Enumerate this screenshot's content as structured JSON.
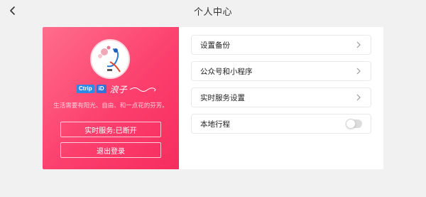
{
  "header": {
    "title": "个人中心",
    "back_icon": "chevron-left-icon"
  },
  "profile": {
    "brand_chip_1": "Ctrip",
    "brand_chip_2": "iD",
    "brand_name": "浪子",
    "motto": "生活需要有阳光、自由、和一点花的芬芳。",
    "status_button": "实时服务:已断开",
    "logout_button": "退出登录",
    "panel_color": "#fc3f6e"
  },
  "menu": {
    "items": [
      {
        "label": "设置备份",
        "trailing": "chevron-right-icon"
      },
      {
        "label": "公众号和小程序",
        "trailing": "chevron-right-icon"
      },
      {
        "label": "实时服务设置",
        "trailing": "chevron-right-icon"
      },
      {
        "label": "本地行程",
        "trailing": "toggle",
        "toggle_on": false
      }
    ]
  }
}
